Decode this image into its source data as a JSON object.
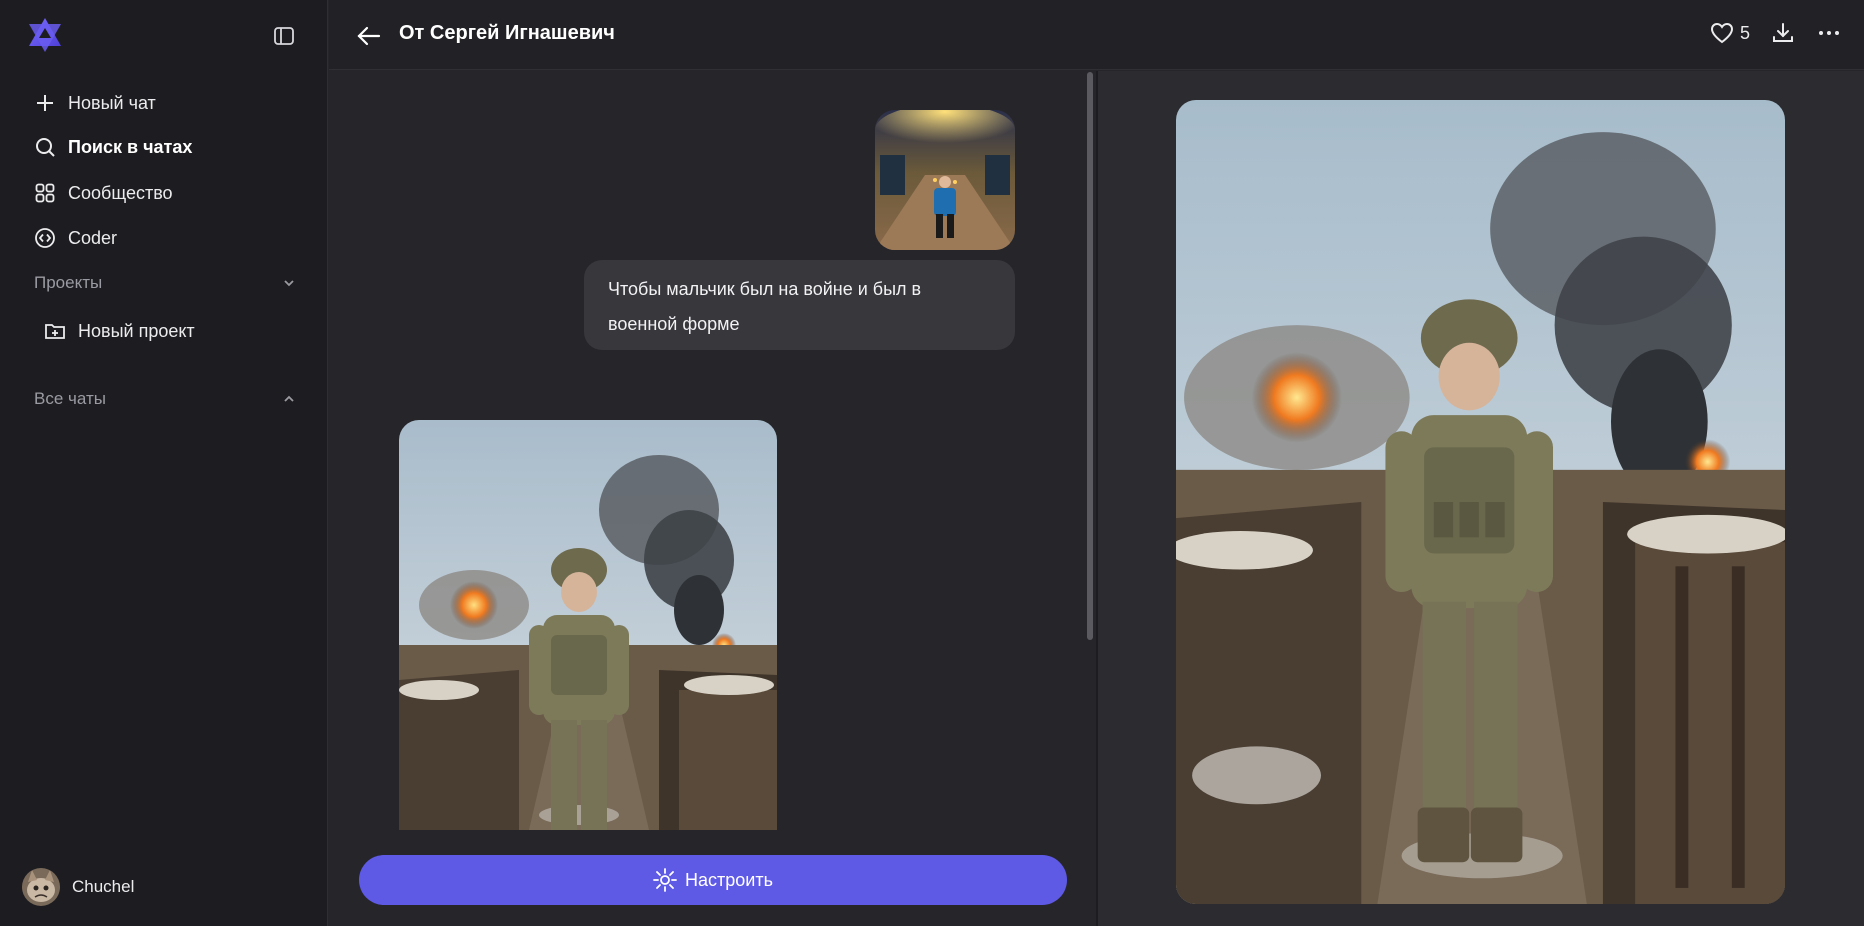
{
  "sidebar": {
    "items": [
      {
        "label": "Новый чат",
        "icon": "plus-icon"
      },
      {
        "label": "Поиск в чатах",
        "icon": "search-icon"
      },
      {
        "label": "Сообщество",
        "icon": "grid-icon"
      },
      {
        "label": "Coder",
        "icon": "code-icon"
      }
    ],
    "projects_label": "Проекты",
    "new_project_label": "Новый проект",
    "all_chats_label": "Все чаты",
    "user_name": "Chuchel"
  },
  "header": {
    "title": "От Сергей Игнашевич",
    "like_count": "5"
  },
  "chat": {
    "message_text": "Чтобы мальчик был на войне и был в военной форме",
    "customize_label": "Настроить"
  },
  "colors": {
    "accent": "#5f5ae6",
    "sidebar_bg": "#1d1d21",
    "bubble_bg": "#37373c"
  }
}
